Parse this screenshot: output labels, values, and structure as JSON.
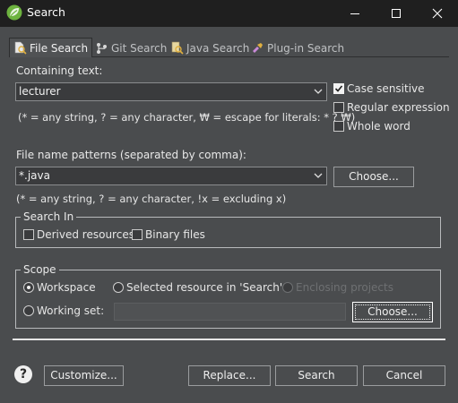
{
  "window": {
    "title": "Search",
    "colors": {
      "titlebar": "#1f1f1f",
      "dialog_bg": "#4a4c4e",
      "field_bg": "#3a3b3d",
      "title_icon": "#6db33f"
    },
    "icons": {
      "app": "spring-leaf-icon",
      "minimize": "minimize-icon",
      "maximize": "maximize-icon",
      "close": "close-icon"
    }
  },
  "tabs": [
    {
      "label": "File Search",
      "icon": "file-search-icon",
      "active": true
    },
    {
      "label": "Git Search",
      "icon": "git-search-icon",
      "active": false
    },
    {
      "label": "Java Search",
      "icon": "java-search-icon",
      "active": false
    },
    {
      "label": "Plug-in Search",
      "icon": "plugin-search-icon",
      "active": false
    }
  ],
  "containing_text": {
    "label": "Containing text:",
    "value": "lecturer",
    "hint": "(* = any string, ? = any character, ₩ = escape for literals: * ? ₩)"
  },
  "options": {
    "case_sensitive": {
      "label": "Case sensitive",
      "checked": true
    },
    "regular_expression": {
      "label": "Regular expression",
      "checked": false
    },
    "whole_word": {
      "label": "Whole word",
      "checked": false
    }
  },
  "file_patterns": {
    "label": "File name patterns (separated by comma):",
    "value": "*.java",
    "hint": "(* = any string, ? = any character, !x = excluding x)",
    "choose_label": "Choose..."
  },
  "search_in": {
    "title": "Search In",
    "derived": {
      "label": "Derived resources",
      "checked": false
    },
    "binary": {
      "label": "Binary files",
      "checked": false
    }
  },
  "scope": {
    "title": "Scope",
    "workspace": {
      "label": "Workspace",
      "selected": true
    },
    "selected_resource": {
      "label": "Selected resource in 'Search'",
      "selected": false
    },
    "enclosing_projects": {
      "label": "Enclosing projects",
      "selected": false,
      "enabled": false
    },
    "working_set": {
      "label": "Working set:",
      "selected": false,
      "value": ""
    },
    "choose_label": "Choose..."
  },
  "footer": {
    "help_label": "?",
    "customize_label": "Customize...",
    "replace_label": "Replace...",
    "search_label": "Search",
    "cancel_label": "Cancel"
  }
}
